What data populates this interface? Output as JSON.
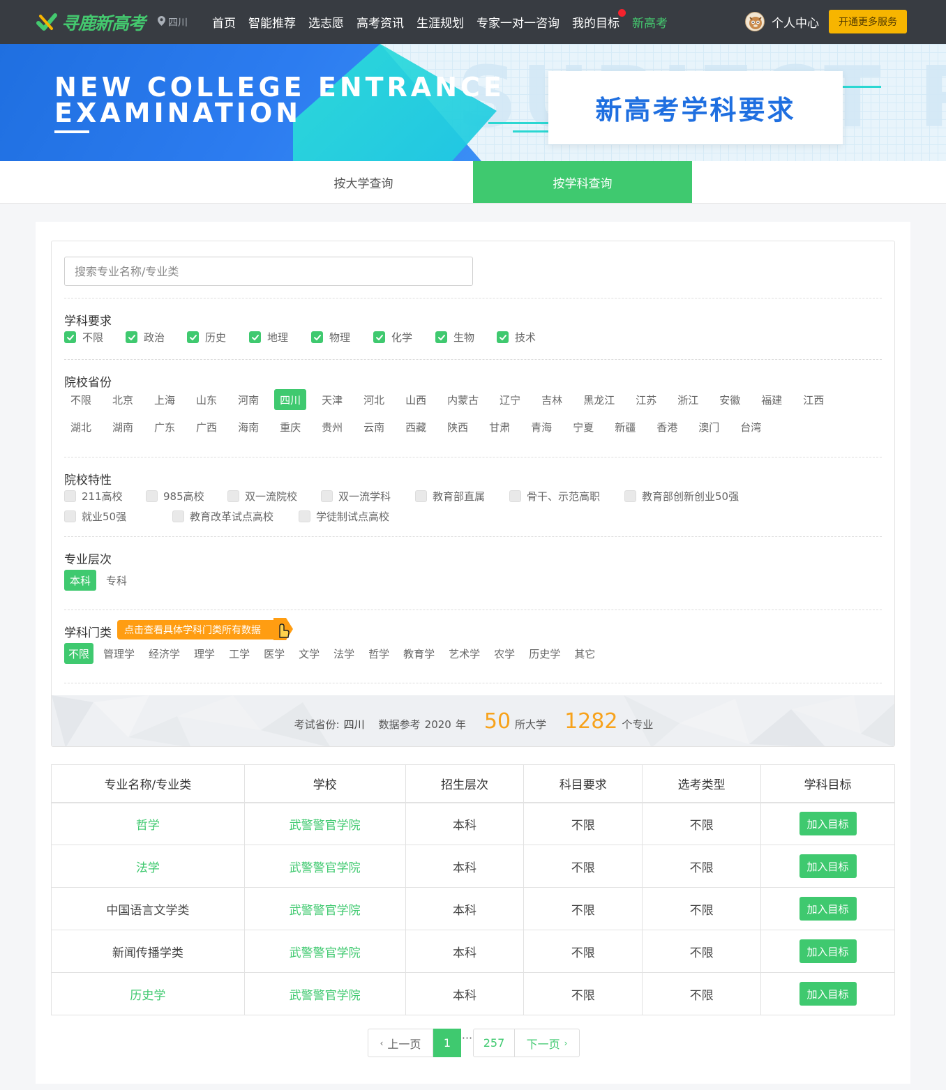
{
  "header": {
    "logo_text": "寻鹿新高考",
    "location": "四川",
    "nav": [
      {
        "label": "首页"
      },
      {
        "label": "智能推荐"
      },
      {
        "label": "选志愿"
      },
      {
        "label": "高考资讯"
      },
      {
        "label": "生涯规划"
      },
      {
        "label": "专家一对一咨询"
      },
      {
        "label": "我的目标"
      },
      {
        "label": "新高考"
      }
    ],
    "user_center": "个人中心",
    "vip_button": "开通更多服务"
  },
  "banner": {
    "en_line1": "NEW COLLEGE ENTRANCE",
    "en_line2": "EXAMINATION",
    "bg_text": "SUBJECT RE",
    "title": "新高考学科要求"
  },
  "tabs": [
    {
      "label": "按大学查询"
    },
    {
      "label": "按学科查询"
    }
  ],
  "filters": {
    "search_placeholder": "搜索专业名称/专业类",
    "subject": {
      "title": "学科要求",
      "options": [
        "不限",
        "政治",
        "历史",
        "地理",
        "物理",
        "化学",
        "生物",
        "技术"
      ]
    },
    "province": {
      "title": "院校省份",
      "selected": "四川",
      "options": [
        "不限",
        "北京",
        "上海",
        "山东",
        "河南",
        "四川",
        "天津",
        "河北",
        "山西",
        "内蒙古",
        "辽宁",
        "吉林",
        "黑龙江",
        "江苏",
        "浙江",
        "安徽",
        "福建",
        "江西",
        "湖北",
        "湖南",
        "广东",
        "广西",
        "海南",
        "重庆",
        "贵州",
        "云南",
        "西藏",
        "陕西",
        "甘肃",
        "青海",
        "宁夏",
        "新疆",
        "香港",
        "澳门",
        "台湾"
      ]
    },
    "feature": {
      "title": "院校特性",
      "options": [
        "211高校",
        "985高校",
        "双一流院校",
        "双一流学科",
        "教育部直属",
        "骨干、示范高职",
        "教育部创新创业50强",
        "就业50强",
        "教育改革试点高校",
        "学徒制试点高校"
      ]
    },
    "level": {
      "title": "专业层次",
      "selected": "本科",
      "options": [
        "本科",
        "专科"
      ]
    },
    "category": {
      "title": "学科门类",
      "hint": "点击查看具体学科门类所有数据",
      "selected": "不限",
      "options": [
        "不限",
        "管理学",
        "经济学",
        "理学",
        "工学",
        "医学",
        "文学",
        "法学",
        "哲学",
        "教育学",
        "艺术学",
        "农学",
        "历史学",
        "其它"
      ]
    }
  },
  "stats": {
    "province_label": "考试省份:",
    "province": "四川",
    "year_prefix": "数据参考",
    "year": "2020",
    "year_suffix": "年",
    "universities": "50",
    "universities_unit": "所大学",
    "majors": "1282",
    "majors_unit": "个专业"
  },
  "table": {
    "headers": [
      "专业名称/专业类",
      "学校",
      "招生层次",
      "科目要求",
      "选考类型",
      "学科目标"
    ],
    "rows": [
      {
        "major": "哲学",
        "school": "武警警官学院",
        "level": "本科",
        "subject": "不限",
        "type": "不限",
        "action": "加入目标"
      },
      {
        "major": "法学",
        "school": "武警警官学院",
        "level": "本科",
        "subject": "不限",
        "type": "不限",
        "action": "加入目标"
      },
      {
        "major": "中国语言文学类",
        "school": "武警警官学院",
        "level": "本科",
        "subject": "不限",
        "type": "不限",
        "action": "加入目标"
      },
      {
        "major": "新闻传播学类",
        "school": "武警警官学院",
        "level": "本科",
        "subject": "不限",
        "type": "不限",
        "action": "加入目标"
      },
      {
        "major": "历史学",
        "school": "武警警官学院",
        "level": "本科",
        "subject": "不限",
        "type": "不限",
        "action": "加入目标"
      }
    ]
  },
  "pagination": {
    "prev": "上一页",
    "current": "1",
    "ellipsis": "···",
    "last": "257",
    "next": "下一页"
  },
  "colors": {
    "accent_green": "#3fc96f",
    "header_bg": "#383c42",
    "vip_yellow": "#f7b500",
    "stat_orange": "#f7a21b",
    "banner_blue": "#1f6fe0"
  }
}
